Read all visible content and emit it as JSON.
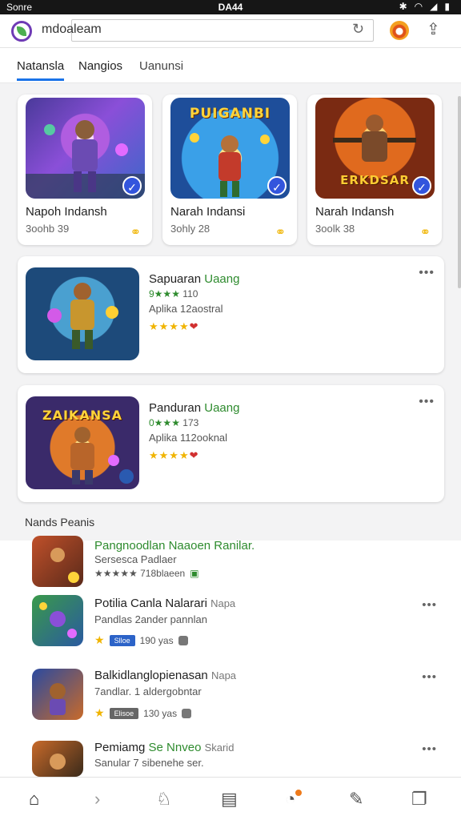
{
  "status_bar": {
    "carrier": "Sonre",
    "time": "DA44",
    "icons": [
      "bluetooth-icon",
      "wifi-icon",
      "signal-icon",
      "battery-icon"
    ]
  },
  "browser": {
    "url": "mdoaleam",
    "icons": [
      "app-logo-icon",
      "reload-icon",
      "extension-icon",
      "share-icon"
    ]
  },
  "tabs": [
    "Natansla",
    "Nangios",
    "Uanunsi"
  ],
  "featured": [
    {
      "title": "Napoh Indansh",
      "sub": "3oohb 39",
      "art_text": ""
    },
    {
      "title": "Narah Indansi",
      "sub": "3ohly 28",
      "art_text": "PUIGANBI"
    },
    {
      "title": "Narah Indansh",
      "sub": "3oolk 38",
      "art_text": "ERKDSAR"
    }
  ],
  "cards": [
    {
      "name": "Sapuaran",
      "name_tag": "Uaang",
      "rating": "9★★★",
      "rating_count": "110",
      "category": "Aplika 12aostral",
      "stars": "★★★★",
      "art_text": ""
    },
    {
      "name": "Panduran",
      "name_tag": "Uaang",
      "rating": "0★★★",
      "rating_count": "173",
      "category": "Aplika 112ooknal",
      "stars": "★★★★",
      "art_text": "ZAIKANSA"
    }
  ],
  "section_title": "Nands Peanis",
  "list": [
    {
      "name": "Pangnoodlan Naaoen Ranilar.",
      "name_hint": "",
      "sub": "Sersesca Padlaer",
      "meta": "★★★★★ 718blaeen",
      "chip": "",
      "meta_value": ""
    },
    {
      "name": "Potilia Canla Nalarari",
      "name_hint": "Napa",
      "sub": "Pandlas 2ander pannlan",
      "meta": "",
      "chip": "Slloe",
      "meta_value": "190 yas"
    },
    {
      "name": "Balkidlanglopienasan",
      "name_hint": "Napa",
      "sub": "7andlar. 1 aldergobntar",
      "meta": "",
      "chip": "Elisoe",
      "meta_value": "130 yas"
    },
    {
      "name": "Pemiamg",
      "name_hint": "Se Nnveo",
      "name_tail": "Skarid",
      "sub": "Sanular 7 sibenehe ser.",
      "meta": "",
      "chip": "",
      "meta_value": ""
    }
  ],
  "colors": {
    "accent": "#1a73e8",
    "green": "#2e8b2e",
    "star": "#f0b400"
  },
  "bottom_nav_icons": [
    "home-icon",
    "forward-icon",
    "bell-icon",
    "news-icon",
    "clock-icon",
    "edit-icon",
    "tabs-icon"
  ]
}
